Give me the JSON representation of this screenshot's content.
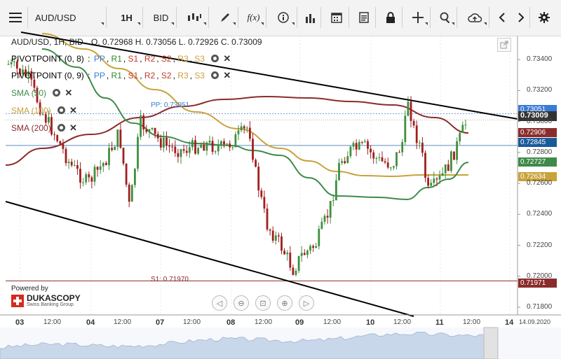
{
  "toolbar": {
    "menu_icon": "hamburger-icon",
    "symbol": "AUD/USD",
    "timeframe": "1H",
    "price_side": "BID",
    "function_label": "f(x)"
  },
  "header": {
    "instrument": "AUD/USD, 1H, BID",
    "ohlc": "O. 0.72968 H. 0.73056 L. 0.72926 C. 0.73009"
  },
  "indicators": [
    {
      "label": "PIVOTPOINT (0, 8)",
      "items": [
        "PP",
        "R1",
        "S1",
        "R2",
        "S2",
        "R3",
        "S3"
      ]
    },
    {
      "label": "PIVOTPOINT (0, 9)",
      "items": [
        "PP",
        "R1",
        "S1",
        "R2",
        "S2",
        "R3",
        "S3"
      ]
    },
    {
      "label": "SMA (50)"
    },
    {
      "label": "SMA (100)"
    },
    {
      "label": "SMA (200)"
    }
  ],
  "colors": {
    "pp": "#3a7bd5",
    "r": "#2a8a2a",
    "s": "#c0392b",
    "sma50": "#3f8a4a",
    "sma100": "#c8a33a",
    "sma200": "#8b2c2c",
    "candle_up": "#3f8f3f",
    "candle_down": "#a11e1e"
  },
  "pivot_labels": {
    "pp": "PP: 0.73051",
    "s1": "S1: 0.71970"
  },
  "price_tags": [
    {
      "text": "0.73051",
      "color": "#3a7bd5"
    },
    {
      "text": "0.73009",
      "color": "#333333"
    },
    {
      "text": "0.72906",
      "color": "#8b2c2c"
    },
    {
      "text": "0.72845",
      "color": "#1a5a9a"
    },
    {
      "text": "0.72727",
      "color": "#3f8a4a"
    },
    {
      "text": "0.72634",
      "color": "#c8a33a"
    },
    {
      "text": "0.71971",
      "color": "#8b2c2c"
    }
  ],
  "branding": {
    "powered_by": "Powered by",
    "brand": "DUKASCOPY",
    "sub": "Swiss Banking Group"
  },
  "chart_data": {
    "type": "line",
    "title": "",
    "ylim": [
      0.7175,
      0.7355
    ],
    "yticks": [
      "0.73400",
      "0.73200",
      "0.73000",
      "0.72800",
      "0.72600",
      "0.72400",
      "0.72200",
      "0.72000",
      "0.71800"
    ],
    "xticks": [
      "03",
      "12:00",
      "04",
      "12:00",
      "07",
      "12:00",
      "08",
      "12:00",
      "09",
      "12:00",
      "10",
      "12:00",
      "11",
      "12:00",
      "14",
      "14.09.2020"
    ],
    "pivot": {
      "PP": 0.73051,
      "S1": 0.7197
    },
    "last_close": 0.73009,
    "series": [
      {
        "name": "SMA (50)",
        "last": 0.72727
      },
      {
        "name": "SMA (100)",
        "last": 0.72634
      },
      {
        "name": "SMA (200)",
        "last": 0.72906
      }
    ]
  }
}
